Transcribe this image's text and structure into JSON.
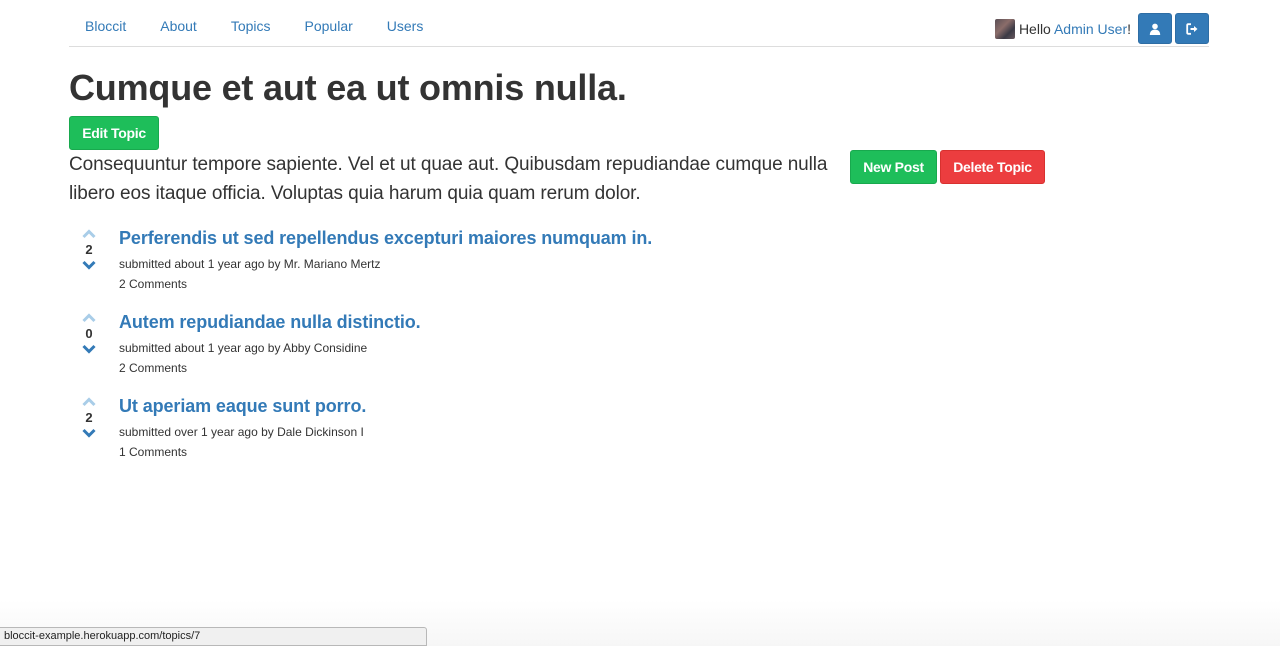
{
  "nav": {
    "links": [
      "Bloccit",
      "About",
      "Topics",
      "Popular",
      "Users"
    ],
    "greeting_prefix": "Hello ",
    "user_name": "Admin User",
    "greeting_suffix": "!"
  },
  "topic": {
    "title": "Cumque et aut ea ut omnis nulla.",
    "description": "Consequuntur tempore sapiente. Vel et ut quae aut. Quibusdam repudiandae cumque nulla libero eos itaque officia. Voluptas quia harum quia quam rerum dolor.",
    "edit_label": "Edit Topic",
    "new_post_label": "New Post",
    "delete_label": "Delete Topic"
  },
  "posts": [
    {
      "title": "Perferendis ut sed repellendus excepturi maiores numquam in.",
      "votes": "2",
      "meta": "submitted about 1 year ago by Mr. Mariano Mertz",
      "comments": "2 Comments"
    },
    {
      "title": "Autem repudiandae nulla distinctio.",
      "votes": "0",
      "meta": "submitted about 1 year ago by Abby Considine",
      "comments": "2 Comments"
    },
    {
      "title": "Ut aperiam eaque sunt porro.",
      "votes": "2",
      "meta": "submitted over 1 year ago by Dale Dickinson I",
      "comments": "1 Comments"
    }
  ],
  "status_bar": {
    "url": "bloccit-example.herokuapp.com/topics/7"
  },
  "icons": {
    "profile": "user-icon",
    "signout": "sign-out-icon",
    "upvote": "chevron-up-icon",
    "downvote": "chevron-down-icon"
  },
  "colors": {
    "link": "#337ab7",
    "success": "#1ebe5a",
    "danger": "#ec3d3f",
    "upvote_faded": "#a9cde8"
  }
}
